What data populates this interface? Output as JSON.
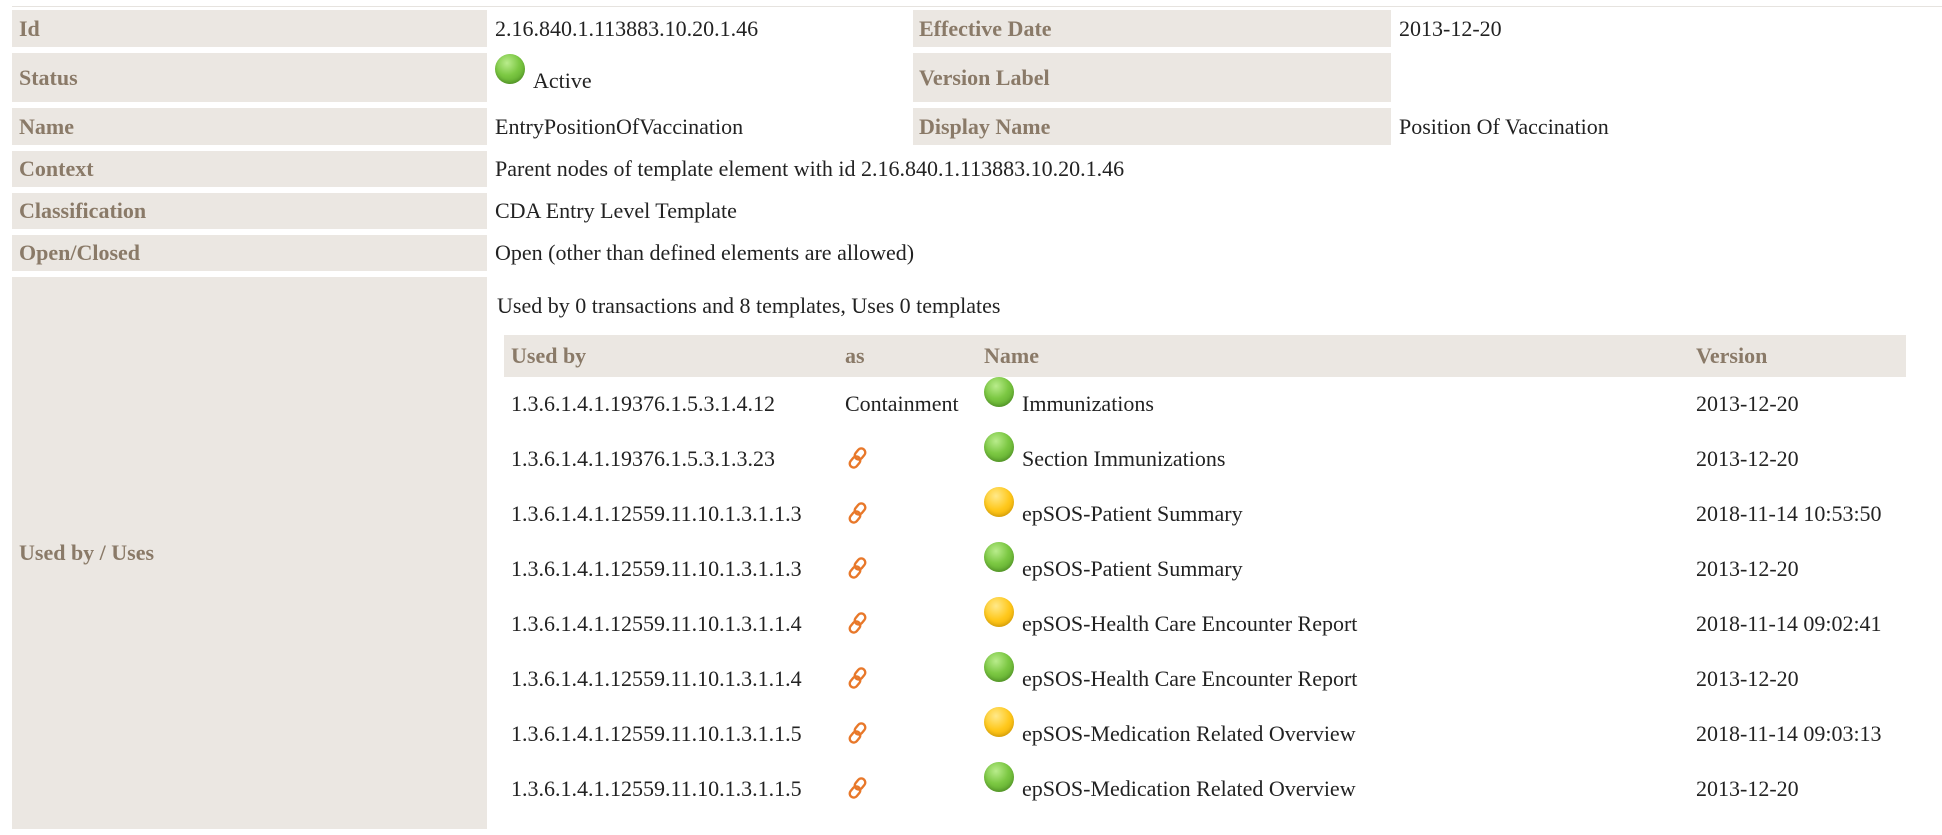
{
  "fields": {
    "id_label": "Id",
    "id_value": "2.16.840.1.113883.10.20.1.46",
    "effective_date_label": "Effective Date",
    "effective_date_value": "2013-12-20",
    "status_label": "Status",
    "status_value": "Active",
    "status_color": "green",
    "version_label_label": "Version Label",
    "version_label_value": "",
    "name_label": "Name",
    "name_value": "EntryPositionOfVaccination",
    "display_name_label": "Display Name",
    "display_name_value": "Position Of Vaccination",
    "context_label": "Context",
    "context_value": "Parent nodes of template element with id 2.16.840.1.113883.10.20.1.46",
    "classification_label": "Classification",
    "classification_value": "CDA Entry Level Template",
    "open_closed_label": "Open/Closed",
    "open_closed_value": "Open (other than defined elements are allowed)",
    "used_by_uses_label": "Used by / Uses"
  },
  "used_by": {
    "summary": "Used by 0 transactions and 8 templates, Uses 0 templates",
    "headers": [
      "Used by",
      "as",
      "Name",
      "Version"
    ],
    "rows": [
      {
        "id": "1.3.6.1.4.1.19376.1.5.3.1.4.12",
        "as": "Containment",
        "as_icon": "",
        "status": "green",
        "name": "Immunizations",
        "version": "2013-12-20"
      },
      {
        "id": "1.3.6.1.4.1.19376.1.5.3.1.3.23",
        "as": "",
        "as_icon": "link-icon",
        "status": "green",
        "name": "Section Immunizations",
        "version": "2013-12-20"
      },
      {
        "id": "1.3.6.1.4.1.12559.11.10.1.3.1.1.3",
        "as": "",
        "as_icon": "link-icon",
        "status": "yellow",
        "name": "epSOS-Patient Summary",
        "version": "2018-11-14 10:53:50"
      },
      {
        "id": "1.3.6.1.4.1.12559.11.10.1.3.1.1.3",
        "as": "",
        "as_icon": "link-icon",
        "status": "green",
        "name": "epSOS-Patient Summary",
        "version": "2013-12-20"
      },
      {
        "id": "1.3.6.1.4.1.12559.11.10.1.3.1.1.4",
        "as": "",
        "as_icon": "link-icon",
        "status": "yellow",
        "name": "epSOS-Health Care Encounter Report",
        "version": "2018-11-14 09:02:41"
      },
      {
        "id": "1.3.6.1.4.1.12559.11.10.1.3.1.1.4",
        "as": "",
        "as_icon": "link-icon",
        "status": "green",
        "name": "epSOS-Health Care Encounter Report",
        "version": "2013-12-20"
      },
      {
        "id": "1.3.6.1.4.1.12559.11.10.1.3.1.1.5",
        "as": "",
        "as_icon": "link-icon",
        "status": "yellow",
        "name": "epSOS-Medication Related Overview",
        "version": "2018-11-14 09:03:13"
      },
      {
        "id": "1.3.6.1.4.1.12559.11.10.1.3.1.1.5",
        "as": "",
        "as_icon": "link-icon",
        "status": "green",
        "name": "epSOS-Medication Related Overview",
        "version": "2013-12-20"
      }
    ]
  },
  "colors": {
    "label_bg": "#ebe7e2",
    "label_text": "#8a7a68",
    "link_icon": "#e8782a",
    "status_green": "#6cbf3a",
    "status_yellow": "#ffc81c"
  }
}
